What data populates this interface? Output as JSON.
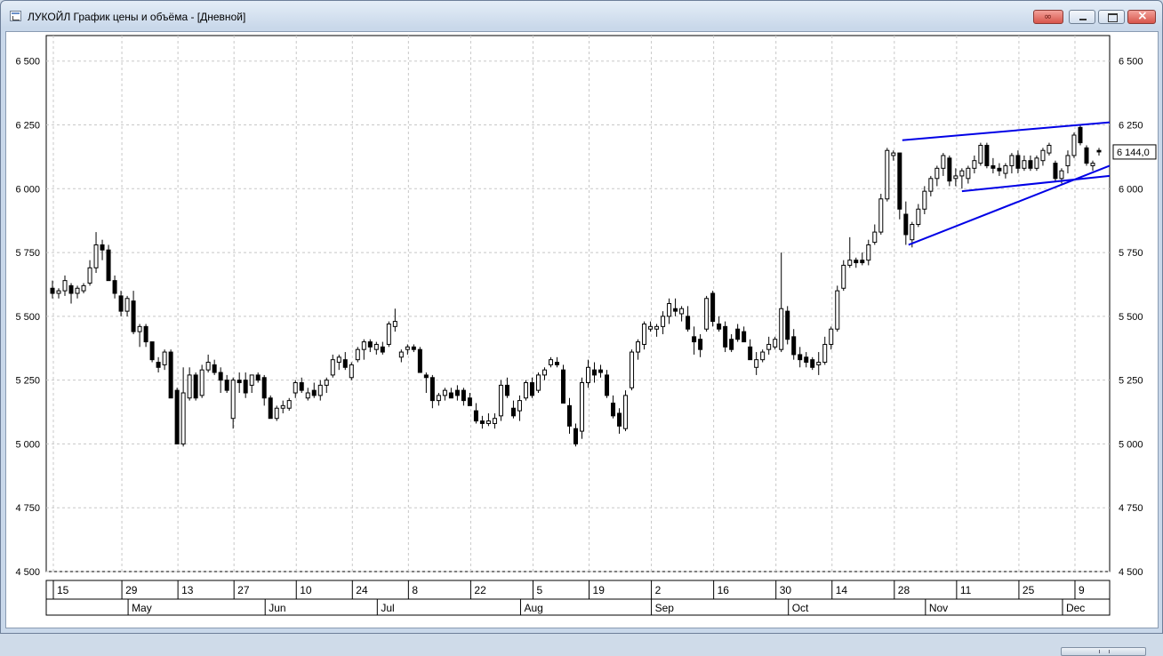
{
  "window": {
    "title": "ЛУКОЙЛ График цены и объёма - [Дневной]",
    "controls": [
      "link",
      "minimize",
      "maximize",
      "close"
    ]
  },
  "colors": {
    "candle_up": "#ffffff",
    "candle_down": "#000000",
    "trendline": "#0000e6",
    "grid": "#c8c8c8",
    "axis": "#000000"
  },
  "chart_data": {
    "type": "candlestick",
    "title": "",
    "ylim": [
      4500,
      6600
    ],
    "y_ticks": [
      4500,
      4750,
      5000,
      5250,
      5500,
      5750,
      6000,
      6250,
      6500
    ],
    "y_tick_labels": [
      "4 500",
      "4 750",
      "5 000",
      "5 250",
      "5 500",
      "5 750",
      "6 000",
      "6 250",
      "6 500"
    ],
    "grid": true,
    "last_price_label": "6 144,0",
    "last_price": 6144,
    "date_ticks": [
      "15",
      "29",
      "13",
      "27",
      "10",
      "24",
      "8",
      "22",
      "5",
      "19",
      "2",
      "16",
      "30",
      "14",
      "28",
      "11",
      "25",
      "9"
    ],
    "month_labels": [
      "May",
      "Jun",
      "Jul",
      "Aug",
      "Sep",
      "Oct",
      "Nov",
      "Dec"
    ],
    "candles": [
      [
        5610,
        5640,
        5570,
        5590
      ],
      [
        5590,
        5610,
        5570,
        5600
      ],
      [
        5600,
        5660,
        5580,
        5640
      ],
      [
        5620,
        5630,
        5550,
        5590
      ],
      [
        5590,
        5620,
        5570,
        5610
      ],
      [
        5600,
        5630,
        5590,
        5620
      ],
      [
        5630,
        5720,
        5620,
        5690
      ],
      [
        5690,
        5830,
        5670,
        5780
      ],
      [
        5780,
        5800,
        5720,
        5760
      ],
      [
        5760,
        5780,
        5640,
        5640
      ],
      [
        5640,
        5660,
        5570,
        5590
      ],
      [
        5580,
        5600,
        5500,
        5520
      ],
      [
        5520,
        5580,
        5500,
        5570
      ],
      [
        5560,
        5600,
        5430,
        5440
      ],
      [
        5440,
        5470,
        5380,
        5460
      ],
      [
        5460,
        5470,
        5380,
        5400
      ],
      [
        5400,
        5400,
        5320,
        5330
      ],
      [
        5320,
        5340,
        5280,
        5300
      ],
      [
        5310,
        5370,
        5290,
        5360
      ],
      [
        5360,
        5370,
        5180,
        5180
      ],
      [
        5210,
        5220,
        5000,
        5000
      ],
      [
        5000,
        5300,
        4990,
        5200
      ],
      [
        5180,
        5300,
        5170,
        5270
      ],
      [
        5270,
        5280,
        5170,
        5180
      ],
      [
        5190,
        5310,
        5180,
        5290
      ],
      [
        5290,
        5350,
        5280,
        5320
      ],
      [
        5310,
        5330,
        5270,
        5280
      ],
      [
        5280,
        5300,
        5200,
        5250
      ],
      [
        5250,
        5270,
        5200,
        5210
      ],
      [
        5100,
        5260,
        5060,
        5250
      ],
      [
        5250,
        5280,
        5200,
        5240
      ],
      [
        5250,
        5280,
        5180,
        5200
      ],
      [
        5230,
        5270,
        5200,
        5270
      ],
      [
        5270,
        5280,
        5240,
        5250
      ],
      [
        5260,
        5270,
        5150,
        5180
      ],
      [
        5180,
        5190,
        5100,
        5100
      ],
      [
        5100,
        5150,
        5090,
        5140
      ],
      [
        5140,
        5170,
        5120,
        5150
      ],
      [
        5140,
        5180,
        5130,
        5170
      ],
      [
        5200,
        5250,
        5180,
        5240
      ],
      [
        5240,
        5260,
        5200,
        5210
      ],
      [
        5180,
        5220,
        5170,
        5200
      ],
      [
        5210,
        5240,
        5180,
        5190
      ],
      [
        5190,
        5250,
        5170,
        5230
      ],
      [
        5230,
        5260,
        5200,
        5250
      ],
      [
        5270,
        5350,
        5260,
        5330
      ],
      [
        5320,
        5350,
        5290,
        5340
      ],
      [
        5330,
        5360,
        5290,
        5300
      ],
      [
        5260,
        5320,
        5250,
        5310
      ],
      [
        5330,
        5380,
        5320,
        5370
      ],
      [
        5370,
        5410,
        5330,
        5400
      ],
      [
        5400,
        5410,
        5360,
        5380
      ],
      [
        5370,
        5400,
        5350,
        5390
      ],
      [
        5380,
        5400,
        5350,
        5360
      ],
      [
        5390,
        5480,
        5380,
        5470
      ],
      [
        5460,
        5530,
        5440,
        5480
      ],
      [
        5340,
        5370,
        5320,
        5360
      ],
      [
        5370,
        5390,
        5350,
        5380
      ],
      [
        5380,
        5390,
        5360,
        5370
      ],
      [
        5370,
        5380,
        5280,
        5280
      ],
      [
        5270,
        5280,
        5200,
        5260
      ],
      [
        5260,
        5270,
        5140,
        5170
      ],
      [
        5170,
        5200,
        5150,
        5190
      ],
      [
        5190,
        5220,
        5170,
        5210
      ],
      [
        5200,
        5220,
        5180,
        5180
      ],
      [
        5210,
        5230,
        5170,
        5190
      ],
      [
        5210,
        5220,
        5150,
        5170
      ],
      [
        5180,
        5200,
        5150,
        5150
      ],
      [
        5130,
        5160,
        5080,
        5090
      ],
      [
        5090,
        5110,
        5060,
        5080
      ],
      [
        5080,
        5120,
        5070,
        5090
      ],
      [
        5080,
        5120,
        5060,
        5100
      ],
      [
        5110,
        5250,
        5090,
        5230
      ],
      [
        5230,
        5260,
        5180,
        5190
      ],
      [
        5140,
        5170,
        5100,
        5110
      ],
      [
        5130,
        5190,
        5090,
        5170
      ],
      [
        5180,
        5250,
        5170,
        5240
      ],
      [
        5240,
        5260,
        5180,
        5190
      ],
      [
        5210,
        5280,
        5200,
        5270
      ],
      [
        5270,
        5300,
        5250,
        5290
      ],
      [
        5310,
        5340,
        5300,
        5330
      ],
      [
        5320,
        5340,
        5300,
        5310
      ],
      [
        5290,
        5310,
        5160,
        5160
      ],
      [
        5150,
        5180,
        5040,
        5070
      ],
      [
        5060,
        5080,
        4990,
        5000
      ],
      [
        5050,
        5260,
        5020,
        5240
      ],
      [
        5240,
        5330,
        5220,
        5300
      ],
      [
        5290,
        5320,
        5240,
        5270
      ],
      [
        5290,
        5310,
        5260,
        5280
      ],
      [
        5270,
        5290,
        5180,
        5190
      ],
      [
        5160,
        5190,
        5100,
        5110
      ],
      [
        5120,
        5140,
        5040,
        5070
      ],
      [
        5060,
        5210,
        5050,
        5190
      ],
      [
        5220,
        5370,
        5210,
        5360
      ],
      [
        5360,
        5410,
        5330,
        5400
      ],
      [
        5390,
        5480,
        5370,
        5470
      ],
      [
        5450,
        5480,
        5440,
        5460
      ],
      [
        5450,
        5470,
        5420,
        5460
      ],
      [
        5460,
        5520,
        5430,
        5500
      ],
      [
        5500,
        5570,
        5470,
        5550
      ],
      [
        5530,
        5570,
        5500,
        5520
      ],
      [
        5510,
        5540,
        5480,
        5530
      ],
      [
        5500,
        5540,
        5440,
        5450
      ],
      [
        5420,
        5460,
        5350,
        5400
      ],
      [
        5410,
        5430,
        5340,
        5370
      ],
      [
        5450,
        5580,
        5440,
        5570
      ],
      [
        5590,
        5600,
        5460,
        5480
      ],
      [
        5470,
        5500,
        5440,
        5450
      ],
      [
        5460,
        5480,
        5360,
        5380
      ],
      [
        5410,
        5430,
        5360,
        5370
      ],
      [
        5450,
        5470,
        5400,
        5410
      ],
      [
        5440,
        5460,
        5400,
        5400
      ],
      [
        5380,
        5410,
        5330,
        5330
      ],
      [
        5300,
        5360,
        5270,
        5330
      ],
      [
        5330,
        5370,
        5320,
        5360
      ],
      [
        5370,
        5420,
        5350,
        5390
      ],
      [
        5380,
        5420,
        5370,
        5410
      ],
      [
        5370,
        5750,
        5360,
        5530
      ],
      [
        5520,
        5540,
        5390,
        5410
      ],
      [
        5420,
        5450,
        5330,
        5350
      ],
      [
        5350,
        5380,
        5300,
        5330
      ],
      [
        5340,
        5360,
        5300,
        5320
      ],
      [
        5330,
        5340,
        5290,
        5300
      ],
      [
        5310,
        5360,
        5270,
        5320
      ],
      [
        5320,
        5420,
        5310,
        5390
      ],
      [
        5390,
        5460,
        5370,
        5450
      ],
      [
        5450,
        5620,
        5440,
        5600
      ],
      [
        5610,
        5720,
        5600,
        5700
      ],
      [
        5700,
        5810,
        5690,
        5720
      ],
      [
        5720,
        5730,
        5690,
        5710
      ],
      [
        5720,
        5750,
        5700,
        5710
      ],
      [
        5720,
        5800,
        5700,
        5780
      ],
      [
        5790,
        5860,
        5780,
        5830
      ],
      [
        5830,
        5980,
        5820,
        5960
      ],
      [
        5960,
        6160,
        5950,
        6150
      ],
      [
        6130,
        6150,
        6110,
        6140
      ],
      [
        6140,
        6140,
        5880,
        5920
      ],
      [
        5900,
        5950,
        5780,
        5820
      ],
      [
        5800,
        5870,
        5770,
        5860
      ],
      [
        5860,
        5940,
        5850,
        5920
      ],
      [
        5920,
        6010,
        5900,
        5990
      ],
      [
        5990,
        6050,
        5970,
        6040
      ],
      [
        6040,
        6090,
        6010,
        6080
      ],
      [
        6080,
        6140,
        6050,
        6130
      ],
      [
        6120,
        6130,
        6010,
        6030
      ],
      [
        6040,
        6080,
        6010,
        6050
      ],
      [
        6050,
        6080,
        6000,
        6070
      ],
      [
        6040,
        6090,
        6020,
        6080
      ],
      [
        6080,
        6130,
        6060,
        6110
      ],
      [
        6100,
        6180,
        6090,
        6170
      ],
      [
        6170,
        6180,
        6080,
        6090
      ],
      [
        6090,
        6120,
        6060,
        6080
      ],
      [
        6080,
        6100,
        6050,
        6070
      ],
      [
        6060,
        6100,
        6040,
        6090
      ],
      [
        6090,
        6140,
        6060,
        6130
      ],
      [
        6130,
        6150,
        6060,
        6080
      ],
      [
        6080,
        6130,
        6070,
        6110
      ],
      [
        6110,
        6130,
        6070,
        6080
      ],
      [
        6080,
        6130,
        6070,
        6120
      ],
      [
        6110,
        6160,
        6090,
        6150
      ],
      [
        6140,
        6180,
        6130,
        6170
      ],
      [
        6100,
        6110,
        6030,
        6040
      ],
      [
        6040,
        6080,
        6020,
        6070
      ],
      [
        6090,
        6150,
        6060,
        6130
      ],
      [
        6130,
        6220,
        6120,
        6210
      ],
      [
        6240,
        6250,
        6170,
        6180
      ],
      [
        6160,
        6170,
        6090,
        6100
      ],
      [
        6090,
        6110,
        6070,
        6100
      ],
      [
        6150,
        6160,
        6130,
        6144
      ]
    ],
    "trendlines": [
      {
        "from": [
          "28",
          6190
        ],
        "to": [
          "9+",
          6260
        ]
      },
      {
        "from": [
          "28",
          5780
        ],
        "to": [
          "9+",
          6090
        ]
      },
      {
        "from": [
          "11",
          5990
        ],
        "to": [
          "9+",
          6050
        ]
      }
    ]
  }
}
